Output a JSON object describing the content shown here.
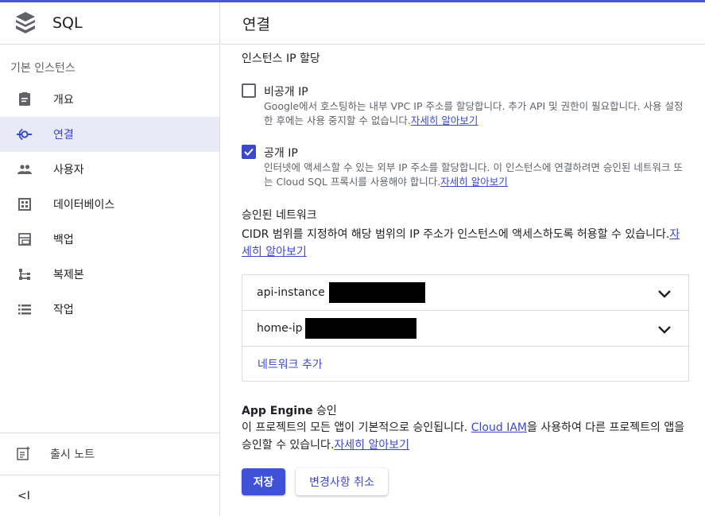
{
  "app": {
    "title": "SQL"
  },
  "sidebar": {
    "section": "기본 인스턴스",
    "items": [
      {
        "label": "개요",
        "icon": "overview-icon"
      },
      {
        "label": "연결",
        "icon": "connections-icon",
        "active": true
      },
      {
        "label": "사용자",
        "icon": "users-icon"
      },
      {
        "label": "데이터베이스",
        "icon": "databases-icon"
      },
      {
        "label": "백업",
        "icon": "backups-icon"
      },
      {
        "label": "복제본",
        "icon": "replicas-icon"
      },
      {
        "label": "작업",
        "icon": "operations-icon"
      }
    ],
    "release_notes": "출시 노트",
    "collapse": "<I"
  },
  "main": {
    "title": "연결",
    "ip_heading": "인스턴스 IP 할당",
    "private_ip": {
      "label": "비공개 IP",
      "checked": false,
      "desc": "Google에서 호스팅하는 내부 VPC IP 주소를 할당합니다. 추가 API 및 권한이 필요합니다. 사용 설정한 후에는 사용 중지할 수 없습니다.",
      "link": "자세히 알아보기"
    },
    "public_ip": {
      "label": "공개 IP",
      "checked": true,
      "desc": "인터넷에 액세스할 수 있는 외부 IP 주소를 할당합니다. 이 인스턴스에 연결하려면 승인된 네트워크 또는 Cloud SQL 프록시를 사용해야 합니다.",
      "link": "자세히 알아보기"
    },
    "auth_heading": "승인된 네트워크",
    "auth_desc": "CIDR 범위를 지정하여 해당 범위의 IP 주소가 인스턴스에 액세스하도록 허용할 수 있습니다.",
    "auth_link": "자세히 알아보기",
    "networks": [
      {
        "name": "api-instance"
      },
      {
        "name": "home-ip"
      }
    ],
    "add_network": "네트워크 추가",
    "app_engine_heading_bold": "App Engine",
    "app_engine_heading_rest": " 승인",
    "app_desc_1": "이 프로젝트의 모든 앱이 기본적으로 승인됩니다. ",
    "app_desc_link_iam": "Cloud IAM",
    "app_desc_2": "을 사용하여 다른 프로젝트의 앱을 승인할 수 있습니다.",
    "app_desc_link": "자세히 알아보기",
    "save": "저장",
    "cancel": "변경사항 취소"
  },
  "colors": {
    "accent": "#3b48c8",
    "active_bg": "#e8eaf6",
    "topline": "#4b57d6"
  }
}
